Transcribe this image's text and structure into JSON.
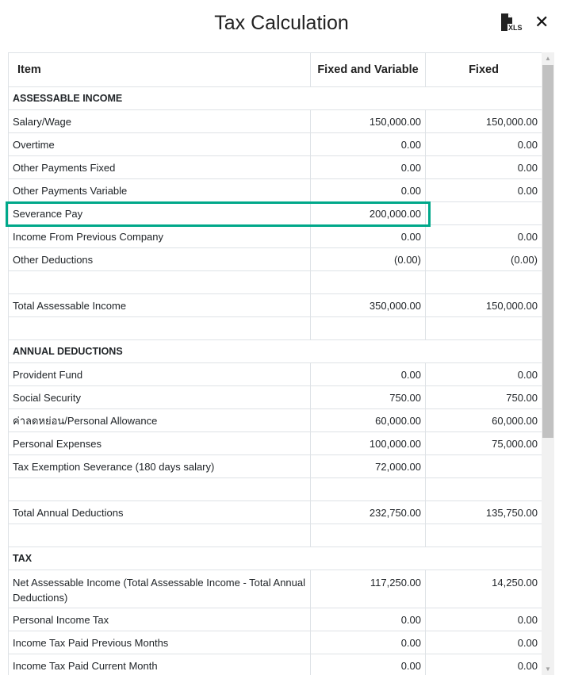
{
  "title": "Tax Calculation",
  "icons": {
    "export": "xls-file-icon",
    "close": "close-icon"
  },
  "export_label": "XLS",
  "highlight_color": "#00a88a",
  "columns": [
    "Item",
    "Fixed and Variable",
    "Fixed"
  ],
  "rows": [
    {
      "type": "section",
      "label": "ASSESSABLE INCOME"
    },
    {
      "label": "Salary/Wage",
      "fv": "150,000.00",
      "f": "150,000.00"
    },
    {
      "label": "Overtime",
      "fv": "0.00",
      "f": "0.00"
    },
    {
      "label": "Other Payments Fixed",
      "fv": "0.00",
      "f": "0.00"
    },
    {
      "label": "Other Payments Variable",
      "fv": "0.00",
      "f": "0.00"
    },
    {
      "label": "Severance Pay",
      "fv": "200,000.00",
      "f": "",
      "highlight": true
    },
    {
      "label": "Income From Previous Company",
      "fv": "0.00",
      "f": "0.00"
    },
    {
      "label": "Other Deductions",
      "fv": "(0.00)",
      "f": "(0.00)"
    },
    {
      "type": "blank"
    },
    {
      "label": "Total Assessable Income",
      "fv": "350,000.00",
      "f": "150,000.00"
    },
    {
      "type": "blank"
    },
    {
      "type": "section",
      "label": "ANNUAL DEDUCTIONS"
    },
    {
      "label": "Provident Fund",
      "fv": "0.00",
      "f": "0.00"
    },
    {
      "label": "Social Security",
      "fv": "750.00",
      "f": "750.00"
    },
    {
      "label": "ค่าลดหย่อน/Personal Allowance",
      "fv": "60,000.00",
      "f": "60,000.00"
    },
    {
      "label": "Personal Expenses",
      "fv": "100,000.00",
      "f": "75,000.00"
    },
    {
      "label": "Tax Exemption Severance (180 days salary)",
      "fv": "72,000.00",
      "f": ""
    },
    {
      "type": "blank"
    },
    {
      "label": "Total Annual Deductions",
      "fv": "232,750.00",
      "f": "135,750.00"
    },
    {
      "type": "blank"
    },
    {
      "type": "section",
      "label": "TAX"
    },
    {
      "label": "Net Assessable Income (Total Assessable Income - Total Annual Deductions)",
      "fv": "117,250.00",
      "f": "14,250.00",
      "tall": true
    },
    {
      "label": "Personal Income Tax",
      "fv": "0.00",
      "f": "0.00"
    },
    {
      "label": "Income Tax Paid Previous Months",
      "fv": "0.00",
      "f": "0.00"
    },
    {
      "label": "Income Tax Paid Current Month",
      "fv": "0.00",
      "f": "0.00"
    }
  ]
}
